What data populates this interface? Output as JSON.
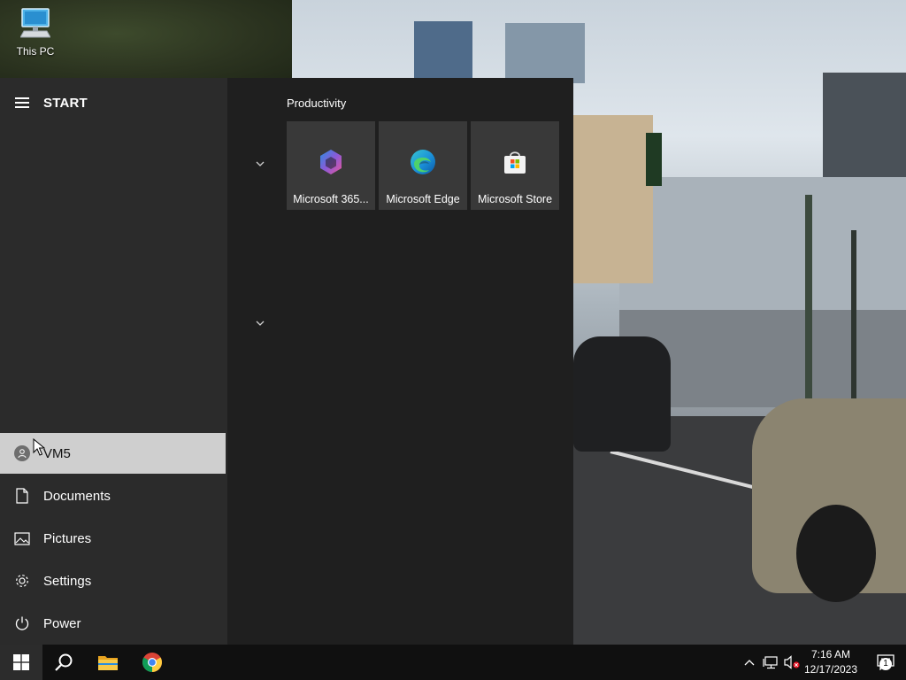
{
  "desktop": {
    "icons": [
      {
        "label": "This PC",
        "icon": "computer-icon"
      }
    ]
  },
  "start_menu": {
    "title": "START",
    "menu_icon": "hamburger-icon",
    "nav_items": [
      {
        "label": "VM5",
        "icon": "user-avatar-icon",
        "active": true
      },
      {
        "label": "Documents",
        "icon": "document-icon"
      },
      {
        "label": "Pictures",
        "icon": "pictures-icon"
      },
      {
        "label": "Settings",
        "icon": "gear-icon"
      },
      {
        "label": "Power",
        "icon": "power-icon"
      }
    ],
    "groups": [
      {
        "label": "Productivity",
        "tiles": [
          {
            "label": "Microsoft 365...",
            "icon": "microsoft-365-icon"
          },
          {
            "label": "Microsoft Edge",
            "icon": "edge-icon"
          },
          {
            "label": "Microsoft Store",
            "icon": "store-icon"
          }
        ]
      }
    ]
  },
  "taskbar": {
    "pinned": [
      {
        "name": "Start",
        "icon": "windows-icon"
      },
      {
        "name": "Search",
        "icon": "search-icon"
      },
      {
        "name": "File Explorer",
        "icon": "folder-icon"
      },
      {
        "name": "Google Chrome",
        "icon": "chrome-icon"
      }
    ],
    "tray": {
      "icons": [
        "chevron-up-icon",
        "network-icon",
        "volume-muted-icon"
      ],
      "time": "7:16 AM",
      "date": "12/17/2023",
      "notification_count": "1"
    }
  },
  "colors": {
    "start_left_bg": "#2b2b2b",
    "start_right_bg": "#1f1f1f",
    "tile_bg": "#393939",
    "taskbar_bg": "#101010",
    "active_item_bg": "#cfcfcf"
  }
}
